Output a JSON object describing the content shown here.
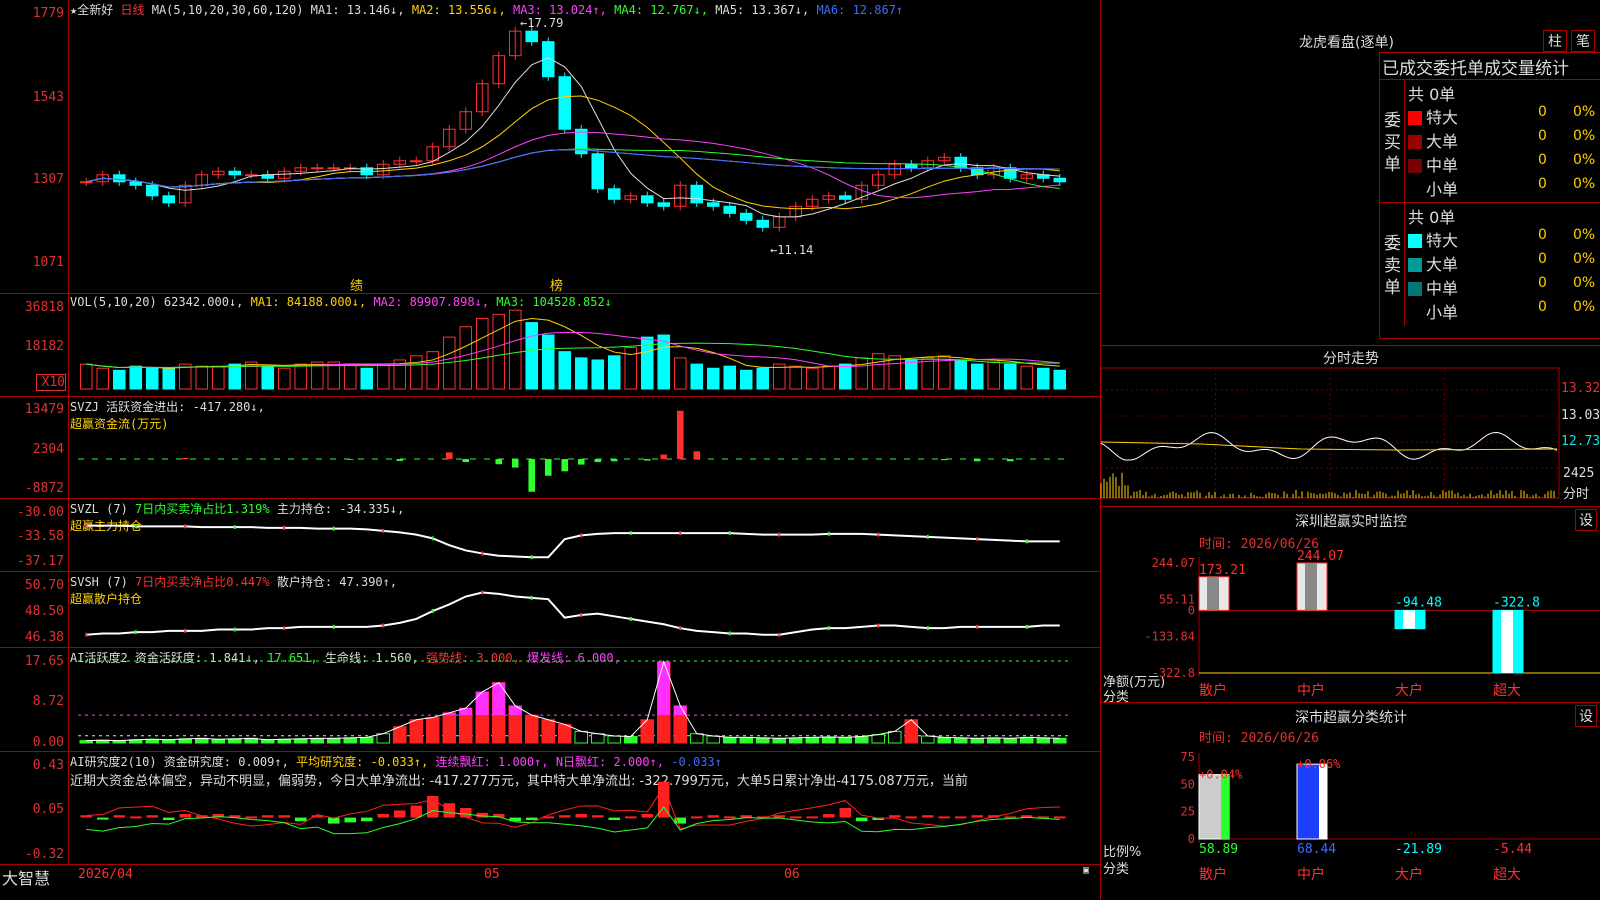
{
  "main": {
    "header": {
      "stock": "★全新好",
      "period": "日线",
      "ma_label": "MA(5,10,20,30,60,120)",
      "ma1": "MA1: 13.146↓,",
      "ma2": "MA2: 13.556↓,",
      "ma3": "MA3: 13.024↑,",
      "ma4": "MA4: 12.767↓,",
      "ma5": "MA5: 13.367↓,",
      "ma6": "MA6: 12.867↑"
    },
    "ticks": [
      "1779",
      "1543",
      "1307",
      "1071"
    ],
    "high_note": "17.79",
    "low_note": "11.14",
    "event_left": "绩",
    "event_right": "榜"
  },
  "vol": {
    "header": "VOL(5,10,20) 62342.000↓,",
    "ma1": "MA1: 84188.000↓,",
    "ma2": "MA2: 89907.898↓,",
    "ma3": "MA3: 104528.852↓",
    "ticks": [
      "36818",
      "18182"
    ],
    "mult": "X10"
  },
  "svzj": {
    "header": "SVZJ  活跃资金进出: -417.280↓,",
    "sub": "超赢资金流(万元)",
    "ticks": [
      "13479",
      "2304",
      "-8872"
    ]
  },
  "svzl": {
    "name": "SVZL (7)",
    "metric": "7日内买卖净占比1.319%",
    "hold": "主力持仓: -34.335↓,",
    "sub": "超赢主力持仓",
    "ticks": [
      "-30.00",
      "-33.58",
      "-37.17"
    ]
  },
  "svsh": {
    "name": "SVSH (7)",
    "metric": "7日内买卖净占比0.447%",
    "hold": "散户持仓: 47.390↑,",
    "sub": "超赢散户持仓",
    "ticks": [
      "50.70",
      "48.50",
      "46.38"
    ]
  },
  "ai1": {
    "h1": "AI活跃度2 资金活跃度: 1.841↓,",
    "h2": "17.651,",
    "h3": "生命线: 1.560,",
    "h4": "强势线: 3.000,",
    "h5": "爆发线: 6.000,",
    "ticks": [
      "17.65",
      "8.72",
      "0.00"
    ]
  },
  "ai2": {
    "h1": "AI研究度2(10) 资金研究度: 0.009↑,",
    "h2": "平均研究度: -0.033↑,",
    "h3": "连续飘红: 1.000↑,",
    "h4": "N日飘红: 2.000↑,",
    "h5": "-0.033↑",
    "summary": "近期大资金总体偏空，异动不明显，偏弱势，今日大单净流出: -417.277万元，其中特大单净流出: -322.799万元，大单5日累计净出-4175.087万元，当前",
    "ticks": [
      "0.43",
      "0.05",
      "-0.32"
    ]
  },
  "bottom": {
    "logo": "大智慧",
    "dates": [
      "2026/04",
      "05",
      "06"
    ]
  },
  "dragon": {
    "title": "龙虎看盘(逐单)",
    "btn1": "柱",
    "btn2": "笔",
    "subtitle": "已成交委托单成交量统计",
    "buy_side": "委买单",
    "sell_side": "委卖单",
    "buy_total": "共 0单",
    "sell_total": "共 0单",
    "buy_rows": [
      {
        "name": "特大",
        "count": "0",
        "pct": "0%",
        "color": "#ff0000"
      },
      {
        "name": "大单",
        "count": "0",
        "pct": "0%",
        "color": "#990000"
      },
      {
        "name": "中单",
        "count": "0",
        "pct": "0%",
        "color": "#770000"
      },
      {
        "name": "小单",
        "count": "0",
        "pct": "0%",
        "color": "#000000"
      }
    ],
    "sell_rows": [
      {
        "name": "特大",
        "count": "0",
        "pct": "0%",
        "color": "#00ffff"
      },
      {
        "name": "大单",
        "count": "0",
        "pct": "0%",
        "color": "#009999"
      },
      {
        "name": "中单",
        "count": "0",
        "pct": "0%",
        "color": "#007777"
      },
      {
        "name": "小单",
        "count": "0",
        "pct": "0%",
        "color": "#000000"
      }
    ]
  },
  "intraday": {
    "title": "分时走势",
    "ticks": [
      "13.32",
      "13.03",
      "12.73",
      "2425"
    ],
    "unit": "分时"
  },
  "monitor": {
    "title": "深圳超赢实时监控",
    "set": "设",
    "date": "时间: 2026/06/26",
    "ylabel": "净额(万元)",
    "xlabel": "分类",
    "ticks": [
      "244.07",
      "55.11",
      "0",
      "-133.84",
      "-322.8"
    ],
    "cats": [
      "散户",
      "中户",
      "大户",
      "超大"
    ],
    "values": [
      173.21,
      244.07,
      -94.48,
      -322.8
    ],
    "labels": [
      "173.21",
      "244.07",
      "-94.48",
      "-322.8"
    ]
  },
  "classify": {
    "title": "深市超赢分类统计",
    "set": "设",
    "date": "时间: 2026/06/26",
    "ylabel": "比例%",
    "xlabel": "分类",
    "ticks": [
      "75",
      "50",
      "25",
      "0"
    ],
    "cats": [
      "散户",
      "中户",
      "大户",
      "超大"
    ],
    "top_labels": [
      "+0.04%",
      "+0.06%"
    ],
    "bottom_labels": [
      "58.89",
      "68.44",
      "-21.89",
      "-5.44"
    ]
  },
  "chart_data": [
    {
      "type": "candlestick",
      "title": "★全新好 日线",
      "ylim": [
        1071,
        1779
      ],
      "ohlc_close": [
        13.0,
        13.2,
        13.0,
        12.9,
        12.6,
        12.4,
        12.9,
        13.2,
        13.3,
        13.2,
        13.2,
        13.1,
        13.3,
        13.4,
        13.4,
        13.4,
        13.4,
        13.2,
        13.5,
        13.6,
        13.6,
        14.0,
        14.5,
        15.0,
        15.8,
        16.6,
        17.3,
        17.0,
        16.0,
        14.5,
        13.8,
        12.8,
        12.5,
        12.6,
        12.4,
        12.3,
        12.9,
        12.4,
        12.3,
        12.1,
        11.9,
        11.7,
        12.0,
        12.3,
        12.5,
        12.6,
        12.5,
        12.9,
        13.2,
        13.5,
        13.4,
        13.6,
        13.7,
        13.4,
        13.2,
        13.4,
        13.1,
        13.2,
        13.1,
        13.0
      ],
      "annotations": [
        "17.79",
        "11.14"
      ]
    },
    {
      "type": "bar",
      "title": "VOL(5,10,20)",
      "ylim": [
        0,
        36818
      ],
      "values": [
        12,
        10,
        9,
        11,
        10,
        10,
        12,
        11,
        11,
        12,
        13,
        11,
        10,
        12,
        13,
        13,
        12,
        10,
        12,
        14,
        16,
        18,
        25,
        30,
        34,
        36,
        38,
        32,
        26,
        18,
        15,
        14,
        16,
        20,
        25,
        26,
        15,
        12,
        10,
        11,
        9,
        10,
        12,
        11,
        10,
        11,
        12,
        15,
        17,
        16,
        14,
        15,
        16,
        14,
        12,
        13,
        12,
        11,
        10,
        9
      ]
    },
    {
      "type": "bar",
      "title": "SVZJ 超赢资金流(万元)",
      "ylim": [
        -8872,
        13479
      ],
      "values": [
        0,
        0,
        0,
        0,
        0,
        0,
        300,
        0,
        0,
        0,
        0,
        0,
        0,
        0,
        0,
        0,
        -200,
        0,
        0,
        -500,
        0,
        0,
        1800,
        -800,
        0,
        -1400,
        -2300,
        -8800,
        -4500,
        -3300,
        -1500,
        -800,
        -600,
        0,
        -400,
        1200,
        13000,
        2100,
        0,
        0,
        0,
        0,
        0,
        0,
        0,
        0,
        0,
        0,
        0,
        0,
        0,
        0,
        -300,
        0,
        -600,
        0,
        -600,
        0,
        0,
        0
      ]
    },
    {
      "type": "line",
      "title": "SVZL (7) 超赢主力持仓",
      "ylim": [
        -37.17,
        -30.0
      ],
      "values": [
        -32.2,
        -32.2,
        -32.2,
        -32.3,
        -32.3,
        -32.3,
        -32.3,
        -32.4,
        -32.4,
        -32.4,
        -32.4,
        -32.5,
        -32.5,
        -32.5,
        -32.6,
        -32.6,
        -32.6,
        -32.7,
        -32.9,
        -33.1,
        -33.4,
        -33.9,
        -34.8,
        -35.5,
        -35.9,
        -36.2,
        -36.3,
        -36.4,
        -36.4,
        -34.0,
        -33.5,
        -33.3,
        -33.2,
        -33.2,
        -33.2,
        -33.2,
        -33.2,
        -33.2,
        -33.2,
        -33.2,
        -33.3,
        -33.4,
        -33.4,
        -33.4,
        -33.4,
        -33.3,
        -33.3,
        -33.3,
        -33.4,
        -33.5,
        -33.6,
        -33.7,
        -33.8,
        -33.9,
        -34.0,
        -34.1,
        -34.2,
        -34.3,
        -34.3,
        -34.3
      ]
    },
    {
      "type": "line",
      "title": "SVSH (7) 超赢散户持仓",
      "ylim": [
        46.38,
        50.7
      ],
      "values": [
        46.7,
        46.8,
        46.8,
        46.9,
        46.9,
        47.0,
        47.0,
        47.0,
        47.1,
        47.1,
        47.1,
        47.2,
        47.2,
        47.3,
        47.3,
        47.3,
        47.3,
        47.3,
        47.4,
        47.6,
        47.9,
        48.5,
        49.0,
        49.6,
        49.9,
        49.8,
        49.6,
        49.5,
        49.4,
        48.0,
        48.2,
        48.3,
        48.1,
        47.9,
        47.7,
        47.5,
        47.2,
        47.0,
        46.9,
        46.8,
        46.8,
        46.7,
        46.7,
        46.9,
        47.1,
        47.2,
        47.2,
        47.3,
        47.4,
        47.4,
        47.3,
        47.2,
        47.2,
        47.3,
        47.3,
        47.3,
        47.3,
        47.3,
        47.4,
        47.4
      ]
    },
    {
      "type": "bar",
      "title": "AI活跃度2",
      "ylim": [
        0,
        17.65
      ],
      "values": [
        0.5,
        0.6,
        0.5,
        0.7,
        0.8,
        0.7,
        0.9,
        1.0,
        0.8,
        0.9,
        1.0,
        0.7,
        0.8,
        0.9,
        1.0,
        1.0,
        1.1,
        1.2,
        2.0,
        3.5,
        5.0,
        5.5,
        6.5,
        7.5,
        11.0,
        13.0,
        8.0,
        6.0,
        5.0,
        4.0,
        2.5,
        2.0,
        1.5,
        1.4,
        5.0,
        17.5,
        8.0,
        2.0,
        1.5,
        1.2,
        1.2,
        1.1,
        1.0,
        1.1,
        1.2,
        1.3,
        1.2,
        1.4,
        1.8,
        2.5,
        5.0,
        1.5,
        1.2,
        1.1,
        1.0,
        1.1,
        1.0,
        1.2,
        1.1,
        1.0
      ]
    },
    {
      "type": "bar",
      "title": "AI研究度2(10)",
      "ylim": [
        -0.32,
        0.43
      ],
      "values": [
        0.02,
        -0.01,
        0.02,
        0.01,
        0.02,
        -0.02,
        0.03,
        0.02,
        0.03,
        0.02,
        0.01,
        0.02,
        0.02,
        -0.03,
        0.02,
        -0.05,
        -0.04,
        -0.03,
        0.03,
        0.06,
        0.1,
        0.18,
        0.12,
        0.08,
        0.04,
        0.03,
        -0.03,
        -0.02,
        0.01,
        0.02,
        0.03,
        0.02,
        -0.02,
        0.01,
        0.03,
        0.3,
        -0.05,
        0.01,
        0.02,
        0.01,
        0.02,
        0.01,
        0.02,
        0.01,
        0.01,
        0.03,
        0.08,
        -0.03,
        -0.02,
        0.02,
        0.01,
        0.02,
        0.01,
        0.01,
        0.02,
        0.02,
        0.01,
        0.02,
        0.01,
        0.01
      ]
    },
    {
      "type": "bar",
      "title": "深圳超赢实时监控",
      "categories": [
        "散户",
        "中户",
        "大户",
        "超大"
      ],
      "values": [
        173.21,
        244.07,
        -94.48,
        -322.8
      ],
      "ylabel": "净额(万元)",
      "xlabel": "分类",
      "ylim": [
        -322.8,
        244.07
      ]
    },
    {
      "type": "bar",
      "title": "深市超赢分类统计",
      "categories": [
        "散户",
        "中户",
        "大户",
        "超大"
      ],
      "values": [
        58.89,
        68.44,
        -21.89,
        -5.44
      ],
      "ylabel": "比例%",
      "xlabel": "分类",
      "ylim": [
        0,
        75
      ]
    }
  ]
}
